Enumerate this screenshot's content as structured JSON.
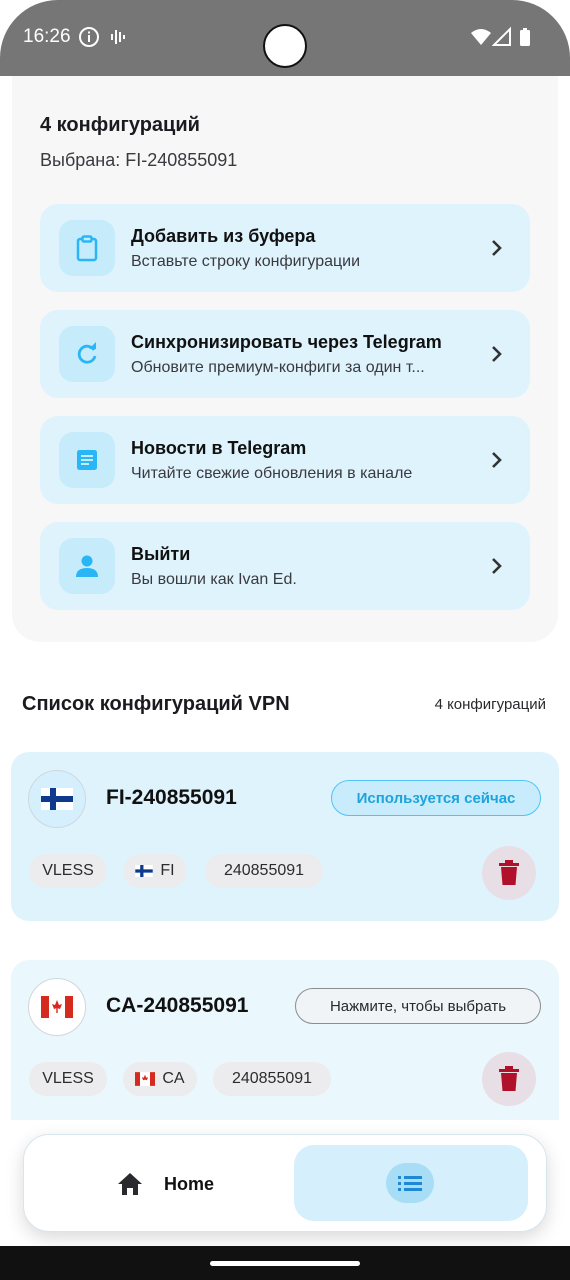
{
  "status_bar": {
    "time": "16:26"
  },
  "header": {
    "count_title": "4 конфигураций",
    "selected": "Выбрана: FI-240855091"
  },
  "actions": [
    {
      "title": "Добавить из буфера",
      "subtitle": "Вставьте строку конфигурации",
      "icon": "clipboard-icon"
    },
    {
      "title": "Синхронизировать через Telegram",
      "subtitle": "Обновите премиум-конфиги за один т...",
      "icon": "refresh-icon"
    },
    {
      "title": "Новости в Telegram",
      "subtitle": "Читайте свежие обновления в канале",
      "icon": "article-icon"
    },
    {
      "title": "Выйти",
      "subtitle": "Вы вошли как Ivan Ed.",
      "icon": "person-icon"
    }
  ],
  "list": {
    "title": "Список конфигураций VPN",
    "count": "4 конфигураций"
  },
  "configs": [
    {
      "name": "FI-240855091",
      "status": "Используется сейчас",
      "protocol": "VLESS",
      "country": "FI",
      "id": "240855091",
      "active": true
    },
    {
      "name": "CA-240855091",
      "status": "Нажмите, чтобы выбрать",
      "protocol": "VLESS",
      "country": "CA",
      "id": "240855091",
      "active": false
    }
  ],
  "nav": {
    "home_label": "Home"
  },
  "colors": {
    "accent": "#29b6f6",
    "accent_bg": "#dff3fd",
    "delete": "#b0102a"
  }
}
